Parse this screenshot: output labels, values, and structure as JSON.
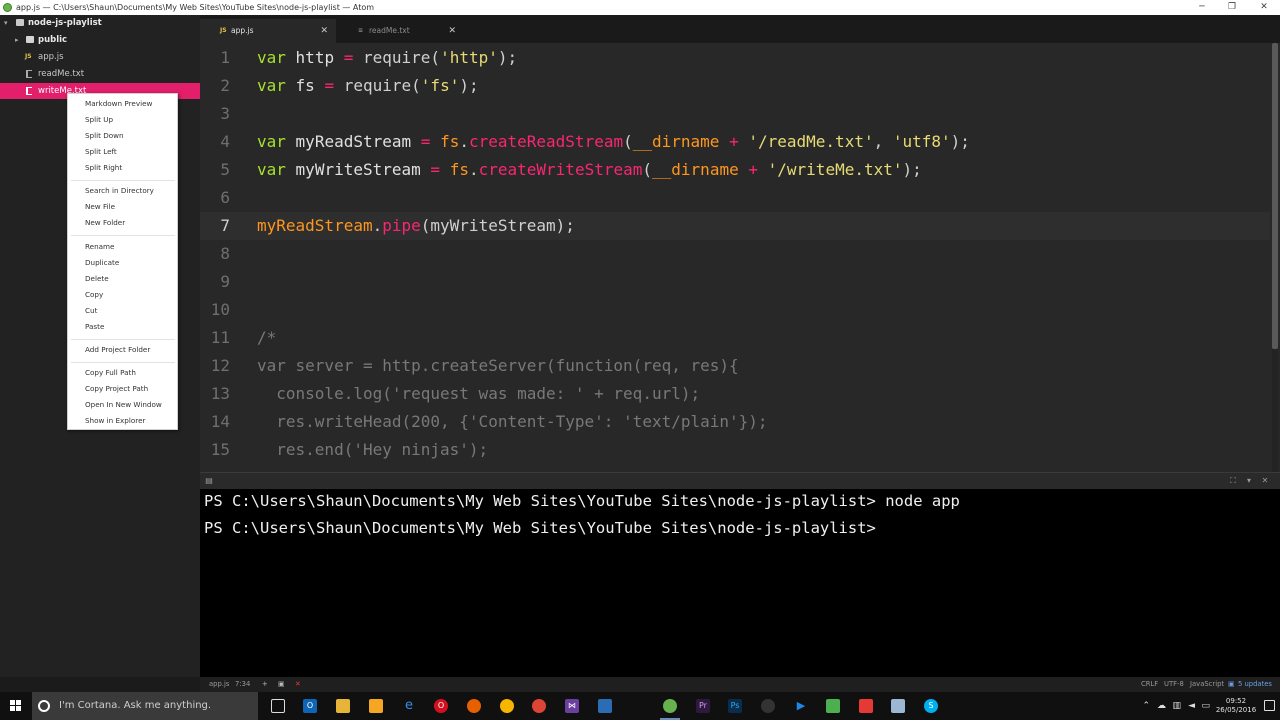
{
  "window": {
    "title": "app.js — C:\\Users\\Shaun\\Documents\\My Web Sites\\YouTube Sites\\node-js-playlist — Atom",
    "minimize": "─",
    "maximize": "❐",
    "close": "✕"
  },
  "tree": {
    "project": "node-js-playlist",
    "items": [
      {
        "label": "public",
        "type": "folder"
      },
      {
        "label": "app.js",
        "type": "js"
      },
      {
        "label": "readMe.txt",
        "type": "txt"
      },
      {
        "label": "writeMe.txt",
        "type": "txt",
        "selected": true
      }
    ]
  },
  "context_menu": {
    "groups": [
      [
        "Markdown Preview",
        "Split Up",
        "Split Down",
        "Split Left",
        "Split Right"
      ],
      [
        "Search in Directory",
        "New File",
        "New Folder"
      ],
      [
        "Rename",
        "Duplicate",
        "Delete",
        "Copy",
        "Cut",
        "Paste"
      ],
      [
        "Add Project Folder"
      ],
      [
        "Copy Full Path",
        "Copy Project Path",
        "Open In New Window",
        "Show in Explorer"
      ]
    ]
  },
  "tabs": [
    {
      "label": "app.js",
      "icon": "JS",
      "active": true
    },
    {
      "label": "readMe.txt",
      "icon": "≡",
      "active": false
    }
  ],
  "editor": {
    "current_line": 7,
    "lines": [
      {
        "n": "1",
        "text": "var http = require('http');"
      },
      {
        "n": "2",
        "text": "var fs = require('fs');"
      },
      {
        "n": "3",
        "text": ""
      },
      {
        "n": "4",
        "text": "var myReadStream = fs.createReadStream(__dirname + '/readMe.txt', 'utf8');"
      },
      {
        "n": "5",
        "text": "var myWriteStream = fs.createWriteStream(__dirname + '/writeMe.txt');"
      },
      {
        "n": "6",
        "text": ""
      },
      {
        "n": "7",
        "text": "myReadStream.pipe(myWriteStream);"
      },
      {
        "n": "8",
        "text": ""
      },
      {
        "n": "9",
        "text": ""
      },
      {
        "n": "10",
        "text": ""
      },
      {
        "n": "11",
        "text": "/*"
      },
      {
        "n": "12",
        "text": "var server = http.createServer(function(req, res){"
      },
      {
        "n": "13",
        "text": "  console.log('request was made: ' + req.url);"
      },
      {
        "n": "14",
        "text": "  res.writeHead(200, {'Content-Type': 'text/plain'});"
      },
      {
        "n": "15",
        "text": "  res.end('Hey ninjas');"
      }
    ]
  },
  "terminal": {
    "lines": [
      "PS C:\\Users\\Shaun\\Documents\\My Web Sites\\YouTube Sites\\node-js-playlist> node app",
      "PS C:\\Users\\Shaun\\Documents\\My Web Sites\\YouTube Sites\\node-js-playlist>"
    ]
  },
  "status": {
    "file": "app.js",
    "cursor": "7:34",
    "line_ending": "CRLF",
    "encoding": "UTF-8",
    "grammar": "JavaScript",
    "updates": "5 updates"
  },
  "taskbar": {
    "search_placeholder": "I'm Cortana. Ask me anything.",
    "time": "09:52",
    "date": "26/05/2016"
  },
  "colors": {
    "accent": "#e31e6b",
    "keyword": "#a6e22e",
    "string": "#e6db74",
    "operator": "#f92672",
    "function": "#fd971f"
  }
}
